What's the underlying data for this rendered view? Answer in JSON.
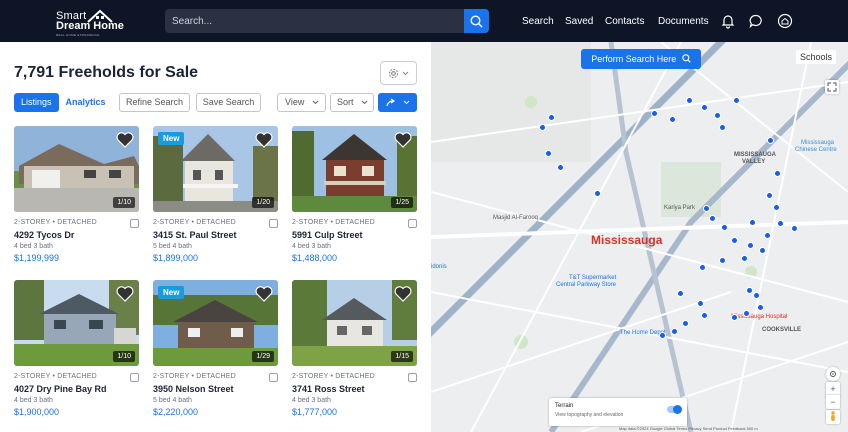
{
  "header": {
    "logo_line1": "Smart",
    "logo_line2": "Dream Home",
    "logo_tagline": "REAL HOME EXPERIENCE",
    "search_placeholder": "Search...",
    "nav": [
      "Search",
      "Saved",
      "Contacts",
      "Documents"
    ],
    "icons": [
      "bell-icon",
      "chat-icon",
      "home-icon"
    ]
  },
  "listing": {
    "title": "7,791 Freeholds for Sale",
    "tabs": [
      "Listings",
      "Analytics"
    ],
    "buttons": {
      "refine": "Refine Search",
      "save": "Save Search",
      "view": "View",
      "sort": "Sort"
    },
    "cards": [
      {
        "type": "2-STOREY • DETACHED",
        "address": "4292 Tycos Dr",
        "beds": "4 bed 3 bath",
        "price": "$1,199,999",
        "counter": "1/10",
        "badge": ""
      },
      {
        "type": "2-STOREY • DETACHED",
        "address": "3415 St. Paul Street",
        "beds": "5 bed 4 bath",
        "price": "$1,899,000",
        "counter": "1/20",
        "badge": "New"
      },
      {
        "type": "2-STOREY • DETACHED",
        "address": "5991 Culp Street",
        "beds": "4 bed 3 bath",
        "price": "$1,488,000",
        "counter": "1/25",
        "badge": ""
      },
      {
        "type": "2-STOREY • DETACHED",
        "address": "4027 Dry Pine Bay Rd",
        "beds": "4 bed 3 bath",
        "price": "$1,900,000",
        "counter": "1/10",
        "badge": ""
      },
      {
        "type": "2-STOREY • DETACHED",
        "address": "3950 Nelson Street",
        "beds": "5 bed 4 bath",
        "price": "$2,220,000",
        "counter": "1/29",
        "badge": "New"
      },
      {
        "type": "2-STOREY • DETACHED",
        "address": "3741 Ross Street",
        "beds": "4 bed 3 bath",
        "price": "$1,777,000",
        "counter": "1/15",
        "badge": ""
      }
    ]
  },
  "map": {
    "perform_search": "Perform Search Here",
    "schools": "Schools",
    "city": "Mississauga",
    "labels": {
      "kariya": "Kariya Park",
      "tnt": "T&T Supermarket",
      "tnt2": "Central Parkway Store",
      "masjid": "Masjid Al-Farooq",
      "valley": "MISSISSAUGA",
      "valley2": "VALLEY",
      "chinese": "Mississauga",
      "chinese2": "Chinese Centre",
      "hospital": "Mississauga Hospital",
      "cooksville": "COOKSVILLE",
      "homedepot": "The Home Depot",
      "idonis": "idonis"
    },
    "terrain_title": "Terrain",
    "terrain_desc": "View topography and elevation",
    "attribution": "Map data ©2024 Google   Global   Terms   Privacy   Send Product Feedback   500 m",
    "zoom_in": "+",
    "zoom_out": "−"
  },
  "colors": {
    "accent": "#1a73e8",
    "topbar": "#0e1526",
    "city_label": "#d93025",
    "pin": "#1a5cf0"
  }
}
